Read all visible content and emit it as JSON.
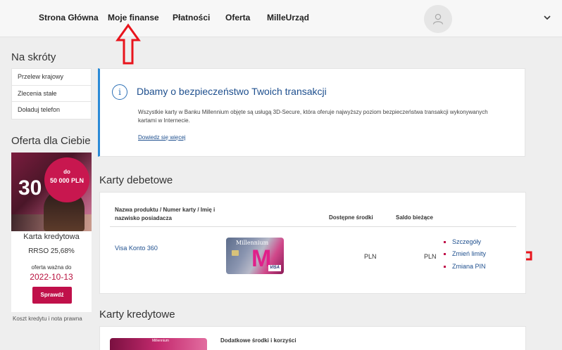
{
  "nav": {
    "items": [
      "Strona Główna",
      "Moje finanse",
      "Płatności",
      "Oferta",
      "MilleUrząd"
    ]
  },
  "shortcuts": {
    "title": "Na skróty",
    "items": [
      "Przelew krajowy",
      "Zlecenia stałe",
      "Doładuj telefon"
    ]
  },
  "offer": {
    "title": "Oferta dla Ciebie",
    "badge_line1": "do",
    "badge_amount": "50 000 PLN",
    "big_text": "30",
    "product": "Karta kredytowa",
    "rrso": "RRSO 25,68%",
    "valid_label": "oferta ważna do",
    "valid_date": "2022-10-13",
    "button": "Sprawdź",
    "cost_link": "Koszt kredytu i nota prawna"
  },
  "info": {
    "icon": "i",
    "title": "Dbamy o bezpieczeństwo Twoich transakcji",
    "text": "Wszystkie karty w Banku Millennium objęte są usługą 3D-Secure, która oferuje najwyższy poziom bezpieczeństwa transakcji wykonywanych kartami w Internecie.",
    "link": "Dowiedz się więcej"
  },
  "debit": {
    "title": "Karty debetowe",
    "headers": {
      "product": "Nazwa produktu / Numer karty / Imię i nazwisko posiadacza",
      "available": "Dostępne środki",
      "balance": "Saldo bieżące"
    },
    "row": {
      "product": "Visa Konto 360",
      "card_brand": "Millennium",
      "card_mark": "M",
      "card_network": "VISA",
      "available": "PLN",
      "balance": "PLN"
    },
    "actions": [
      "Szczegóły",
      "Zmień limity",
      "Zmiana PIN"
    ]
  },
  "credit": {
    "title": "Karty kredytowe",
    "row_label": "Dodatkowe środki i korzyści",
    "card_brand": "Millennium"
  },
  "colors": {
    "accent_red": "#c0104a",
    "link_blue": "#1e4f8e",
    "annotation_red": "#e8141c"
  }
}
